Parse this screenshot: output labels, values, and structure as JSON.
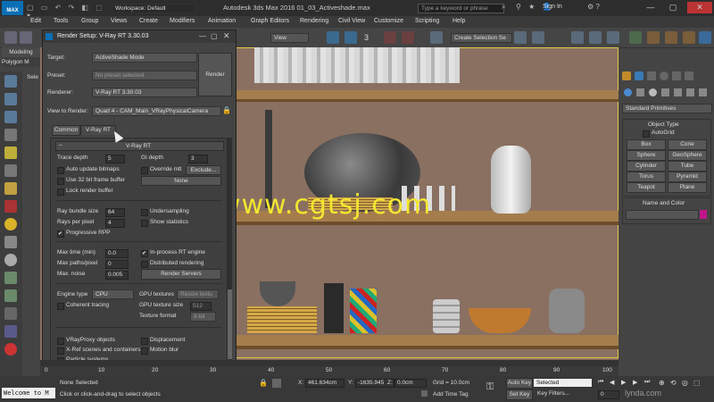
{
  "app": {
    "window_title": "Autodesk 3ds Max 2016     01_03_Activeshade.max",
    "workspace": "Workspace: Default",
    "search_placeholder": "Type a keyword or phrase",
    "sign_in": "Sign In",
    "logo": "MAX"
  },
  "menus": [
    "Edit",
    "Tools",
    "Group",
    "Views",
    "Create",
    "Modifiers",
    "Animation",
    "Graph Editors",
    "Rendering",
    "Civil View",
    "Customize",
    "Scripting",
    "Help"
  ],
  "toolbar": {
    "view_dropdown": "View",
    "selection_set": "Create Selection Se",
    "coord": "3"
  },
  "ribbon_tabs": [
    "Modeling",
    "Polygon M"
  ],
  "ribbon_select": "Sele",
  "dialog": {
    "title": "Render Setup: V-Ray RT 3.30.03",
    "target_label": "Target:",
    "target_value": "ActiveShade Mode",
    "preset_label": "Preset:",
    "preset_value": "No preset selected",
    "renderer_label": "Renderer:",
    "renderer_value": "V-Ray RT 3.30.03",
    "view_label": "View to Render:",
    "view_value": "Quad 4 - CAM_Main_VRayPhysicalCamera",
    "render_button": "Render",
    "tabs": [
      "Common",
      "V-Ray RT"
    ],
    "rollout_title": "V-Ray RT",
    "trace_depth_label": "Trace depth",
    "trace_depth": "5",
    "gi_depth_label": "GI depth",
    "gi_depth": "3",
    "auto_update": "Auto update bitmaps",
    "override_mtl": "Override mtl",
    "exclude": "Exclude...",
    "use32": "Use 32 bit frame buffer",
    "none_btn": "None",
    "lock_render": "Lock render buffer",
    "ray_bundle_label": "Ray bundle size",
    "ray_bundle": "64",
    "rays_pixel_label": "Rays per pixel",
    "rays_pixel": "4",
    "undersampling": "Undersampling",
    "show_stats": "Show statistics",
    "progressive": "Progressive RPP",
    "max_time_label": "Max time (min)",
    "max_time": "0.0",
    "max_paths_label": "Max paths/pixel",
    "max_paths": "0",
    "max_noise_label": "Max. noise",
    "max_noise": "0.005",
    "inprocess": "In-process RT engine",
    "distributed": "Distributed rendering",
    "render_servers": "Render Servers",
    "engine_label": "Engine type",
    "engine_value": "CPU",
    "gpu_tex_label": "GPU textures",
    "gpu_tex_value": "Resize textu",
    "coherent": "Coherent tracing",
    "gpu_size_label": "GPU texture size",
    "gpu_size": "512",
    "tex_format_label": "Texture format",
    "tex_format": "8-bit",
    "vrayproxy": "VRayProxy objects",
    "displacement": "Displacement",
    "xref": "X-Ref scenes and containers",
    "motion_blur": "Motion blur",
    "particles": "Particle systems"
  },
  "viewport": {
    "watermark": "www.cgtsj.com"
  },
  "command_panel": {
    "category": "Standard Primitives",
    "object_type_title": "Object Type",
    "autogrid": "AutoGrid",
    "buttons": [
      "Box",
      "Cone",
      "Sphere",
      "GeoSphere",
      "Cylinder",
      "Tube",
      "Torus",
      "Pyramid",
      "Teapot",
      "Plane"
    ],
    "name_color_title": "Name and Color"
  },
  "timeline": {
    "ticks": [
      "0",
      "10",
      "20",
      "30",
      "40",
      "50",
      "60",
      "70",
      "80",
      "90",
      "100"
    ]
  },
  "status": {
    "maxscript": "Welcome to M",
    "selection": "None Selected",
    "prompt": "Click or click-and-drag to select objects",
    "x_label": "X:",
    "x": "461.634cm",
    "y_label": "Y:",
    "y": "-1635.945",
    "z_label": "Z:",
    "z": "0.0cm",
    "grid": "Grid = 10.0cm",
    "add_time_tag": "Add Time Tag",
    "auto_key": "Auto Key",
    "set_key": "Set Key",
    "selected": "Selected",
    "key_filters": "Key Filters...",
    "frame": "0",
    "brand": "lynda.com"
  },
  "colors": {
    "accent": "#0a6fb5",
    "viewport_border": "#e3c84b",
    "name_swatch": "#c0168a"
  }
}
